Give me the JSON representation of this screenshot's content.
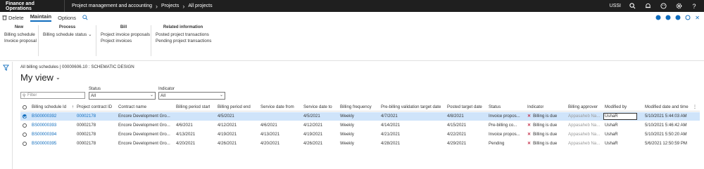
{
  "topbar": {
    "app_title": "Finance and Operations",
    "breadcrumbs": [
      "Project management and accounting",
      "Projects",
      "All projects"
    ],
    "company": "USSI"
  },
  "actionpane": {
    "delete_label": "Delete",
    "tabs": [
      "Maintain",
      "Options"
    ],
    "groups": [
      {
        "title": "New",
        "items": [
          "Billing schedule",
          "Invoice proposal"
        ]
      },
      {
        "title": "Process",
        "items": [
          "Billing schedule status"
        ]
      },
      {
        "title": "Bill",
        "items": [
          "Project invoice proposals",
          "Project invoices"
        ]
      },
      {
        "title": "Related information",
        "items": [
          "Posted project transactions",
          "Pending project transactions"
        ]
      }
    ]
  },
  "page": {
    "breadcrumb": "All billing schedules  |  00000606.10 : SCHEMATIC DESIGN",
    "title": "My view"
  },
  "filters": {
    "search_placeholder": "Filter",
    "status_label": "Status",
    "status_value": "All",
    "indicator_label": "Indicator",
    "indicator_value": "All"
  },
  "grid": {
    "columns": [
      "Billing schedule Id",
      "Project contract ID",
      "Contract name",
      "Billing period start",
      "Billing period end",
      "Service date from",
      "Service date to",
      "Billing frequency",
      "Pre-billing validation target date",
      "Posted target date",
      "Status",
      "Indicator",
      "Billing approver",
      "Modified by",
      "Modified date and time"
    ],
    "sort_indicator": "↑",
    "rows": [
      [
        "BS00000392",
        "00002178",
        "Encore Development Gro...",
        "",
        "4/5/2021",
        "",
        "4/5/2021",
        "Weekly",
        "4/7/2021",
        "4/8/2021",
        "Invoice propos...",
        "Billing is due",
        "Appasaheb Na...",
        "UshaR",
        "5/10/2021 5:44:03 AM"
      ],
      [
        "BS00000393",
        "00002178",
        "Encore Development Gro...",
        "4/6/2021",
        "4/12/2021",
        "4/6/2021",
        "4/12/2021",
        "Weekly",
        "4/14/2021",
        "4/15/2021",
        "Pre-billing co...",
        "Billing is due",
        "Appasaheb Na...",
        "UshaR",
        "5/10/2021 5:46:42 AM"
      ],
      [
        "BS00000394",
        "00002178",
        "Encore Development Gro...",
        "4/13/2021",
        "4/19/2021",
        "4/13/2021",
        "4/19/2021",
        "Weekly",
        "4/21/2021",
        "4/22/2021",
        "Invoice propos...",
        "Billing is due",
        "Appasaheb Na...",
        "UshaR",
        "5/10/2021 5:50:20 AM"
      ],
      [
        "BS00000395",
        "00002178",
        "Encore Development Gro...",
        "4/20/2021",
        "4/26/2021",
        "4/20/2021",
        "4/26/2021",
        "Weekly",
        "4/28/2021",
        "4/29/2021",
        "Pending",
        "Billing is due",
        "Appasaheb Na...",
        "UshaR",
        "5/6/2021 12:50:59 PM"
      ]
    ]
  },
  "colors": {
    "accent": "#0f6cbd",
    "selected_row": "#cfe4fa",
    "error": "#c4314b",
    "topbar": "#1f1f1f"
  }
}
